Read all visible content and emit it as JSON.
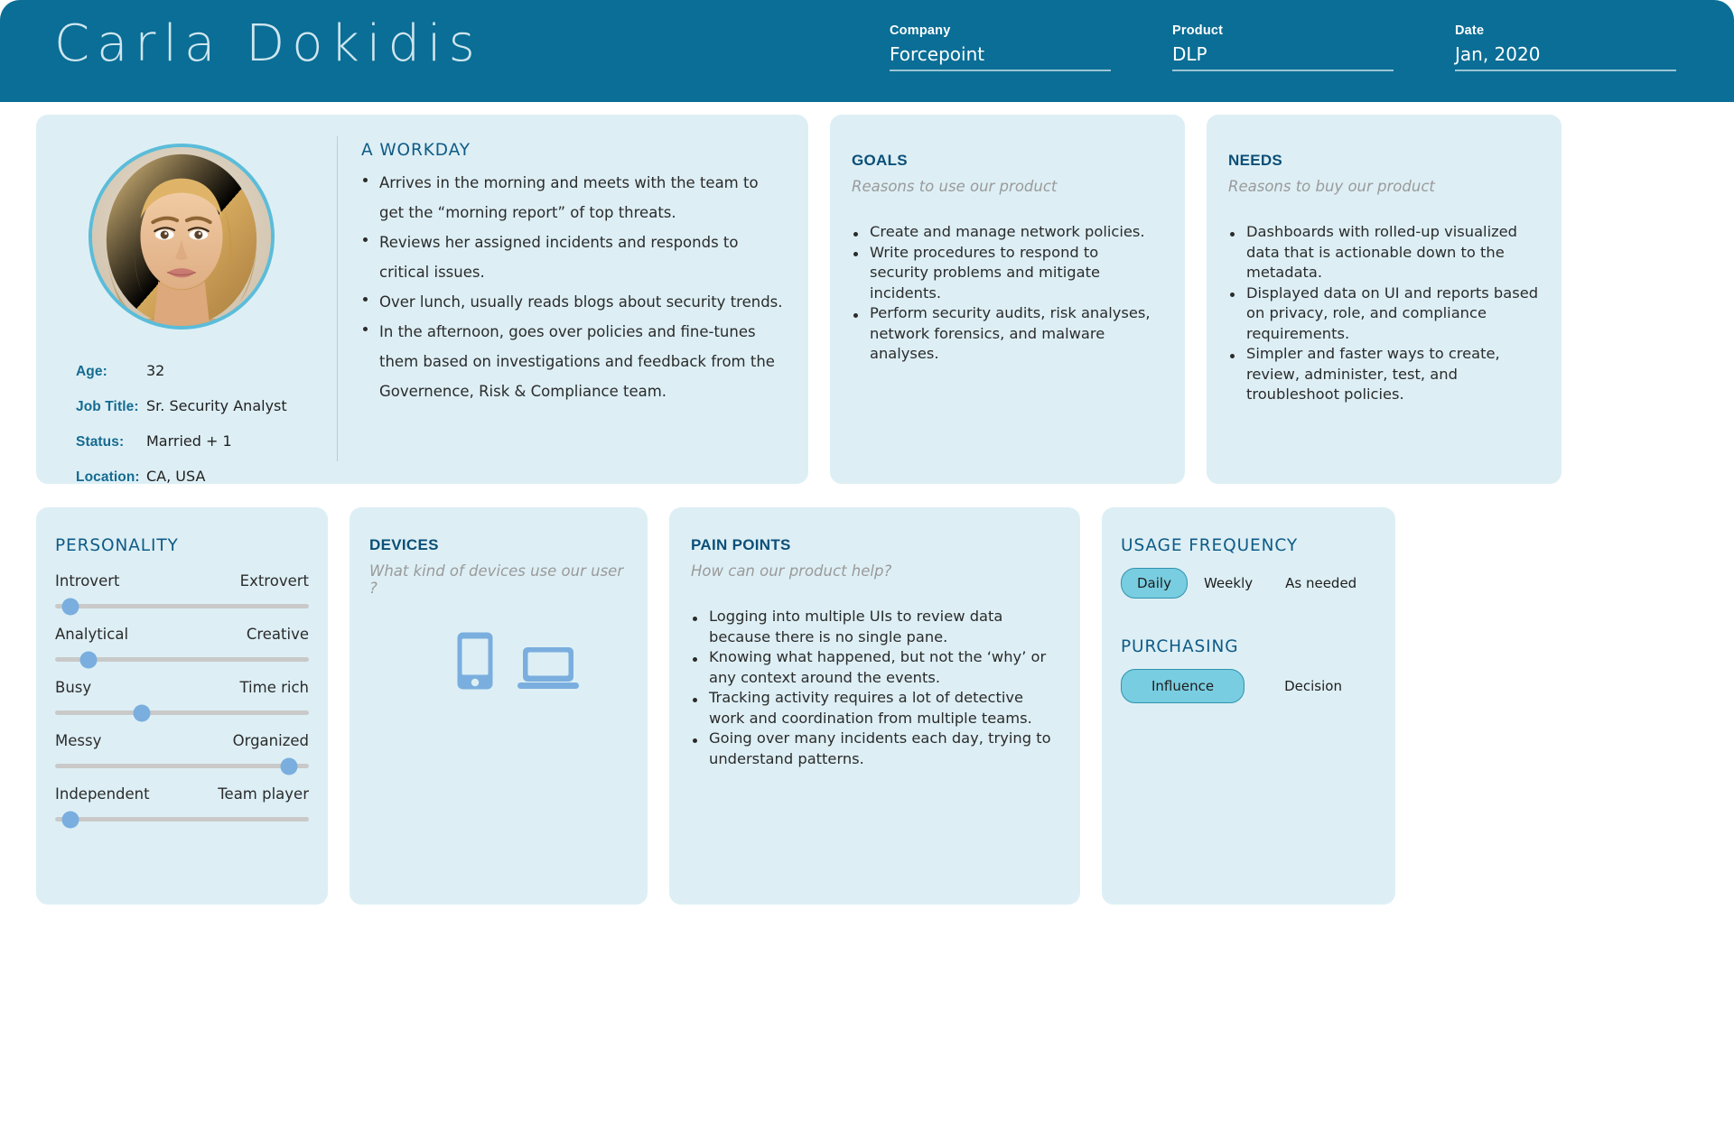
{
  "header": {
    "persona_name": "Carla Dokidis",
    "fields": [
      {
        "label": "Company",
        "value": "Forcepoint"
      },
      {
        "label": "Product",
        "value": "DLP"
      },
      {
        "label": "Date",
        "value": "Jan, 2020"
      }
    ],
    "bar_color": "#0a6e96"
  },
  "profile": {
    "avatar_name": "portrait-photo",
    "avatar_ring_color": "#5bbcd9",
    "facts": [
      {
        "key": "Age:",
        "value": "32"
      },
      {
        "key": "Job Title:",
        "value": "Sr. Security Analyst"
      },
      {
        "key": "Status:",
        "value": "Married + 1"
      },
      {
        "key": "Location:",
        "value": "CA, USA"
      }
    ]
  },
  "workday": {
    "title": "A WORKDAY",
    "items": [
      "Arrives in the morning and meets with the team to get the “morning report” of top threats.",
      "Reviews her assigned incidents and responds to critical issues.",
      "Over lunch, usually reads blogs about security trends.",
      "In the afternoon, goes over policies and fine-tunes them based on investigations and feedback from the Governence, Risk & Compliance team."
    ]
  },
  "goals": {
    "title": "GOALS",
    "subtitle": "Reasons to use our product",
    "items": [
      "Create and manage network policies.",
      "Write procedures to respond to security problems and mitigate incidents.",
      "Perform security audits, risk analyses, network forensics, and malware analyses."
    ]
  },
  "needs": {
    "title": "NEEDS",
    "subtitle": "Reasons to buy our product",
    "items": [
      "Dashboards with rolled-up visualized data that is actionable down to the metadata.",
      "Displayed data on UI and reports based on privacy, role, and compliance requirements.",
      "Simpler and faster ways to create, review, administer, test, and troubleshoot policies."
    ]
  },
  "personality": {
    "title": "PERSONALITY",
    "knob_color": "#7aaede",
    "track_color": "#c9c9c9",
    "sliders": [
      {
        "left": "Introvert",
        "right": "Extrovert",
        "value": 6
      },
      {
        "left": "Analytical",
        "right": "Creative",
        "value": 13
      },
      {
        "left": "Busy",
        "right": "Time rich",
        "value": 34
      },
      {
        "left": "Messy",
        "right": "Organized",
        "value": 92
      },
      {
        "left": "Independent",
        "right": "Team player",
        "value": 6
      }
    ]
  },
  "devices": {
    "title": "DEVICES",
    "subtitle": "What kind of devices use our user ?",
    "icon_color": "#7aaede",
    "icons": [
      "smartphone-icon",
      "laptop-icon"
    ]
  },
  "pain_points": {
    "title": "PAIN POINTS",
    "subtitle": "How can our product help?",
    "items": [
      "Logging into multiple UIs to review data because there is no single pane.",
      "Knowing what happened, but not the ‘why’ or any context around the events.",
      "Tracking activity requires a lot of detective work and coordination from multiple teams.",
      "Going over many incidents each day, trying to understand patterns."
    ]
  },
  "usage_frequency": {
    "title": "USAGE FREQUENCY",
    "options": [
      {
        "label": "Daily",
        "selected": true
      },
      {
        "label": "Weekly",
        "selected": false
      },
      {
        "label": "As needed",
        "selected": false
      }
    ]
  },
  "purchasing": {
    "title": "PURCHASING",
    "options": [
      {
        "label": "Influence",
        "selected": true
      },
      {
        "label": "Decision",
        "selected": false
      }
    ]
  },
  "colors": {
    "card_bg": "#ddeff5",
    "accent": "#0a6e96",
    "heading": "#0f5b86",
    "pill_on_bg": "#79cde0",
    "pill_on_border": "#2f93ae"
  }
}
